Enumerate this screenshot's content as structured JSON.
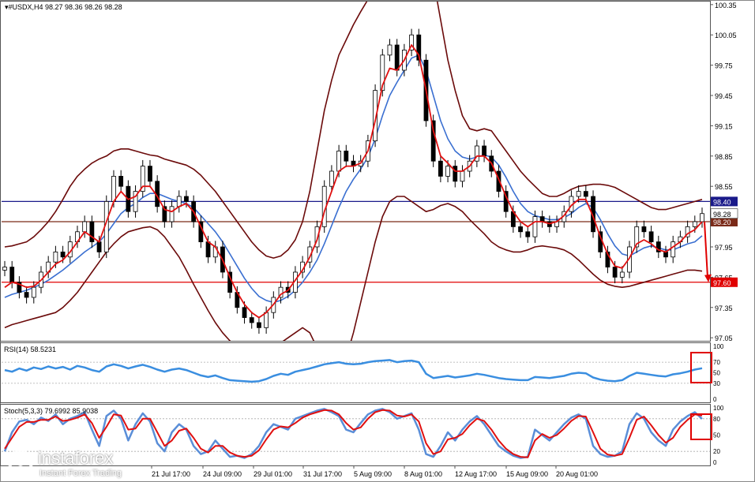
{
  "header": {
    "symbol": "#USDX,H4",
    "ohlc": "98.27 98.36 98.26 98.28"
  },
  "colors": {
    "price": "#000000",
    "bollinger": "#6b0a0a",
    "ma_fast": "#e01010",
    "ma_slow": "#3a6fd1",
    "hline_blue": "#1a1a8a",
    "hline_brown": "#7a2a18",
    "hline_red": "#e00000",
    "rsi": "#3a8ee0",
    "stoch_main": "#5a8ed8",
    "stoch_signal": "#e01010",
    "annotation": "#e00000"
  },
  "chart_data": [
    {
      "type": "line",
      "name": "price-panel",
      "ylim": [
        97.02,
        100.38
      ],
      "y_ticks": [
        "100.35",
        "100.05",
        "99.75",
        "99.45",
        "99.15",
        "98.85",
        "98.55",
        "98.25",
        "97.95",
        "97.65",
        "97.35",
        "97.05"
      ],
      "x_ticks": [
        "21 Jul 17:00",
        "24 Jul 09:00",
        "29 Jul 01:00",
        "31 Jul 17:00",
        "5 Aug 09:00",
        "8 Aug 01:00",
        "12 Aug 17:00",
        "15 Aug 09:00",
        "20 Aug 01:00"
      ],
      "price": [
        97.75,
        97.6,
        97.5,
        97.45,
        97.55,
        97.7,
        97.8,
        97.9,
        97.85,
        98.0,
        98.1,
        98.2,
        98.0,
        97.9,
        98.4,
        98.65,
        98.55,
        98.3,
        98.5,
        98.75,
        98.6,
        98.35,
        98.2,
        98.35,
        98.45,
        98.4,
        98.2,
        98.0,
        97.85,
        97.95,
        97.7,
        97.5,
        97.35,
        97.25,
        97.2,
        97.15,
        97.3,
        97.45,
        97.55,
        97.5,
        97.7,
        97.8,
        97.95,
        98.15,
        98.55,
        98.7,
        98.9,
        98.8,
        98.75,
        98.8,
        99.0,
        99.5,
        99.85,
        99.95,
        99.7,
        99.9,
        100.05,
        99.8,
        99.2,
        98.8,
        98.65,
        98.75,
        98.6,
        98.7,
        98.8,
        98.95,
        98.85,
        98.7,
        98.5,
        98.3,
        98.15,
        98.1,
        98.05,
        98.25,
        98.2,
        98.15,
        98.2,
        98.3,
        98.45,
        98.5,
        98.45,
        98.1,
        97.9,
        97.75,
        97.65,
        97.7,
        97.95,
        98.15,
        98.1,
        98.0,
        97.9,
        97.85,
        98.0,
        98.05,
        98.15,
        98.2,
        98.28
      ],
      "ma_fast": [
        97.55,
        97.6,
        97.58,
        97.55,
        97.56,
        97.62,
        97.7,
        97.78,
        97.82,
        97.9,
        98.0,
        98.1,
        98.05,
        98.0,
        98.2,
        98.4,
        98.5,
        98.42,
        98.45,
        98.55,
        98.55,
        98.45,
        98.32,
        98.3,
        98.35,
        98.38,
        98.3,
        98.15,
        98.0,
        97.95,
        97.82,
        97.65,
        97.5,
        97.38,
        97.3,
        97.25,
        97.3,
        97.38,
        97.48,
        97.52,
        97.62,
        97.72,
        97.85,
        98.02,
        98.3,
        98.5,
        98.7,
        98.75,
        98.75,
        98.78,
        98.9,
        99.2,
        99.55,
        99.72,
        99.7,
        99.8,
        99.95,
        99.85,
        99.5,
        99.1,
        98.85,
        98.78,
        98.7,
        98.7,
        98.75,
        98.85,
        98.85,
        98.78,
        98.62,
        98.45,
        98.3,
        98.2,
        98.15,
        98.2,
        98.2,
        98.18,
        98.2,
        98.26,
        98.36,
        98.42,
        98.42,
        98.25,
        98.05,
        97.88,
        97.76,
        97.74,
        97.84,
        97.98,
        98.02,
        97.98,
        97.92,
        97.9,
        97.95,
        98.0,
        98.08,
        98.12,
        98.2
      ],
      "ma_slow": [
        97.45,
        97.48,
        97.5,
        97.52,
        97.55,
        97.58,
        97.62,
        97.67,
        97.72,
        97.78,
        97.84,
        97.9,
        97.95,
        98.0,
        98.08,
        98.18,
        98.28,
        98.34,
        98.38,
        98.44,
        98.48,
        98.48,
        98.45,
        98.42,
        98.4,
        98.38,
        98.34,
        98.26,
        98.18,
        98.1,
        98.0,
        97.88,
        97.76,
        97.64,
        97.54,
        97.46,
        97.42,
        97.4,
        97.42,
        97.46,
        97.52,
        97.6,
        97.7,
        97.82,
        97.98,
        98.16,
        98.34,
        98.5,
        98.62,
        98.72,
        98.84,
        99.02,
        99.25,
        99.45,
        99.58,
        99.7,
        99.82,
        99.85,
        99.7,
        99.45,
        99.2,
        99.02,
        98.9,
        98.84,
        98.82,
        98.84,
        98.86,
        98.84,
        98.76,
        98.64,
        98.5,
        98.38,
        98.3,
        98.26,
        98.24,
        98.22,
        98.22,
        98.24,
        98.28,
        98.34,
        98.38,
        98.34,
        98.22,
        98.08,
        97.96,
        97.88,
        97.86,
        97.9,
        97.94,
        97.96,
        97.94,
        97.92,
        97.92,
        97.95,
        97.98,
        98.0,
        98.06
      ],
      "bb_upper": [
        97.95,
        97.96,
        97.98,
        98.0,
        98.05,
        98.12,
        98.2,
        98.3,
        98.42,
        98.55,
        98.65,
        98.72,
        98.78,
        98.82,
        98.85,
        98.9,
        98.92,
        98.92,
        98.9,
        98.88,
        98.86,
        98.85,
        98.82,
        98.8,
        98.78,
        98.76,
        98.72,
        98.66,
        98.58,
        98.5,
        98.4,
        98.3,
        98.2,
        98.1,
        98.0,
        97.92,
        97.86,
        97.84,
        97.86,
        97.92,
        98.02,
        98.2,
        98.5,
        98.9,
        99.3,
        99.6,
        99.85,
        100.0,
        100.15,
        100.28,
        100.4,
        100.5,
        100.6,
        100.7,
        100.8,
        100.9,
        101.0,
        101.0,
        100.9,
        100.6,
        100.2,
        99.8,
        99.5,
        99.25,
        99.12,
        99.1,
        99.12,
        99.1,
        99.0,
        98.9,
        98.8,
        98.7,
        98.62,
        98.55,
        98.48,
        98.45,
        98.45,
        98.48,
        98.52,
        98.55,
        98.56,
        98.57,
        98.57,
        98.56,
        98.54,
        98.5,
        98.46,
        98.42,
        98.38,
        98.34,
        98.32,
        98.32,
        98.34,
        98.36,
        98.38,
        98.4,
        98.42
      ],
      "bb_lower": [
        97.15,
        97.18,
        97.2,
        97.22,
        97.24,
        97.26,
        97.28,
        97.3,
        97.35,
        97.42,
        97.5,
        97.6,
        97.7,
        97.8,
        97.9,
        97.98,
        98.05,
        98.1,
        98.12,
        98.14,
        98.15,
        98.12,
        98.05,
        97.95,
        97.85,
        97.72,
        97.58,
        97.45,
        97.32,
        97.2,
        97.1,
        97.02,
        96.95,
        96.9,
        96.88,
        96.88,
        96.9,
        96.95,
        97.0,
        97.05,
        97.1,
        97.15,
        97.1,
        96.95,
        96.8,
        96.7,
        96.72,
        96.85,
        97.1,
        97.4,
        97.7,
        98.0,
        98.25,
        98.4,
        98.45,
        98.45,
        98.4,
        98.35,
        98.3,
        98.32,
        98.36,
        98.38,
        98.35,
        98.3,
        98.22,
        98.15,
        98.08,
        98.0,
        97.95,
        97.92,
        97.9,
        97.9,
        97.92,
        97.95,
        97.96,
        97.95,
        97.94,
        97.92,
        97.88,
        97.82,
        97.75,
        97.68,
        97.62,
        97.58,
        97.56,
        97.55,
        97.56,
        97.58,
        97.6,
        97.62,
        97.64,
        97.66,
        97.68,
        97.7,
        97.72,
        97.72,
        97.71
      ],
      "hlines": [
        {
          "value": 98.4,
          "label": "98.40"
        },
        {
          "value": 98.2,
          "label": "98.20"
        },
        {
          "value": 97.6,
          "label": "97.60"
        }
      ],
      "last_price_label": "98.28",
      "arrow": {
        "from": 98.2,
        "to": 97.6
      }
    },
    {
      "type": "line",
      "name": "rsi-panel",
      "title": "RSI(14) 58.5231",
      "ylim": [
        0,
        100
      ],
      "y_ticks": [
        "100",
        "70",
        "50",
        "30",
        "0"
      ],
      "levels": [
        70,
        30
      ],
      "values": [
        55,
        52,
        58,
        54,
        60,
        57,
        62,
        58,
        61,
        56,
        63,
        60,
        55,
        52,
        62,
        66,
        63,
        58,
        62,
        65,
        61,
        56,
        52,
        56,
        58,
        55,
        50,
        45,
        42,
        45,
        40,
        36,
        35,
        34,
        33,
        34,
        38,
        44,
        48,
        46,
        52,
        55,
        58,
        62,
        66,
        68,
        70,
        67,
        66,
        67,
        70,
        72,
        73,
        74,
        70,
        72,
        73,
        70,
        48,
        40,
        42,
        44,
        41,
        43,
        45,
        48,
        46,
        43,
        40,
        38,
        37,
        36,
        36,
        42,
        41,
        40,
        42,
        44,
        48,
        50,
        49,
        41,
        37,
        35,
        34,
        36,
        44,
        50,
        48,
        46,
        44,
        43,
        47,
        49,
        52,
        56,
        58.5
      ]
    },
    {
      "type": "line",
      "name": "stoch-panel",
      "title": "Stoch(5,3,3) 79.6992 85.9038",
      "ylim": [
        0,
        100
      ],
      "y_ticks": [
        "100",
        "80",
        "50",
        "20",
        "0"
      ],
      "levels": [
        80,
        20
      ],
      "main": [
        20,
        55,
        75,
        78,
        70,
        82,
        76,
        88,
        70,
        80,
        85,
        92,
        60,
        30,
        85,
        95,
        80,
        40,
        70,
        90,
        75,
        35,
        20,
        55,
        70,
        60,
        30,
        15,
        20,
        40,
        25,
        10,
        12,
        8,
        15,
        30,
        55,
        70,
        65,
        60,
        80,
        85,
        90,
        95,
        98,
        92,
        85,
        60,
        55,
        72,
        88,
        95,
        98,
        92,
        80,
        85,
        90,
        60,
        15,
        10,
        30,
        55,
        40,
        60,
        75,
        85,
        70,
        50,
        30,
        20,
        12,
        8,
        10,
        60,
        50,
        40,
        55,
        70,
        82,
        88,
        80,
        30,
        15,
        10,
        12,
        20,
        70,
        90,
        80,
        55,
        40,
        30,
        60,
        75,
        85,
        92,
        79.7
      ],
      "signal": [
        25,
        45,
        65,
        74,
        74,
        78,
        78,
        84,
        76,
        78,
        82,
        88,
        72,
        45,
        65,
        88,
        86,
        60,
        62,
        80,
        80,
        55,
        30,
        40,
        58,
        62,
        45,
        25,
        18,
        30,
        30,
        18,
        12,
        10,
        12,
        22,
        42,
        60,
        66,
        64,
        72,
        82,
        88,
        92,
        96,
        95,
        88,
        72,
        60,
        64,
        80,
        92,
        96,
        95,
        86,
        84,
        88,
        75,
        35,
        15,
        20,
        42,
        45,
        52,
        68,
        80,
        76,
        60,
        40,
        25,
        15,
        10,
        9,
        40,
        52,
        45,
        50,
        62,
        76,
        85,
        84,
        55,
        25,
        14,
        12,
        15,
        45,
        78,
        84,
        68,
        50,
        36,
        45,
        65,
        78,
        88,
        85.9
      ]
    }
  ],
  "watermark": {
    "name": "instaforex",
    "tagline": "Instant Forex Trading"
  }
}
